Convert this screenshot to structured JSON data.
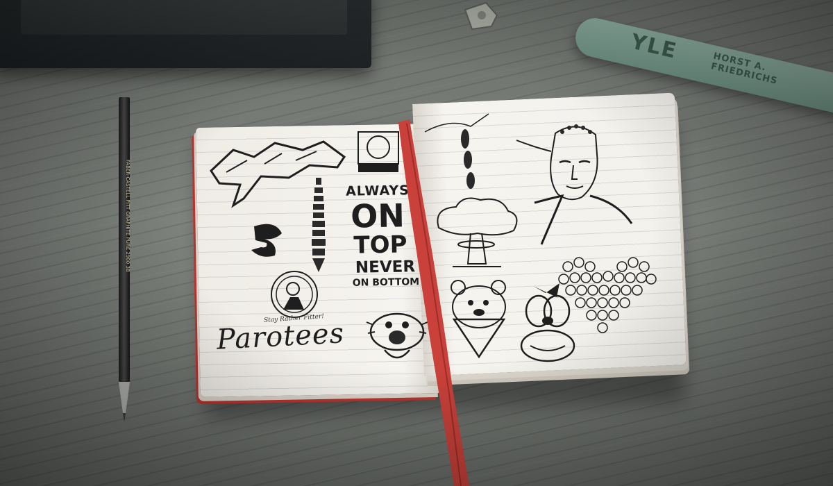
{
  "scene": {
    "marker_text": "YLE",
    "marker_brand_line1": "HORST A.",
    "marker_brand_line2": "FRIEDRICHS",
    "pencil_text": "FABER-CASTELL PITT GRAPHITE PURE 2900 3B"
  },
  "notebook": {
    "left_page": {
      "graffiti_tag_icon": "graffiti-tag",
      "badge_icon": "circle-badge-sketch",
      "always": "ALWAYS",
      "on": "ON",
      "top": "TOP",
      "never": "NEVER",
      "on_bottom": "ON BOTTOM",
      "slogan": "Stay Rather Fitter!",
      "brand": "Parotees"
    },
    "right_page": {
      "bombs_icon": "falling-bombs",
      "mushroom_cloud_icon": "mushroom-cloud",
      "buddha_icon": "buddha-portrait",
      "skull_heart_icon": "skull-heart",
      "bear_icon": "bandana-bear",
      "dog_icon": "cartoon-dog"
    },
    "ribbon_color": "#c9413a"
  },
  "colors": {
    "wood": "#757973",
    "paper": "#f3f1ec",
    "ink": "#1e1e1e",
    "ribbon": "#c9413a",
    "marker": "#7fa193"
  }
}
